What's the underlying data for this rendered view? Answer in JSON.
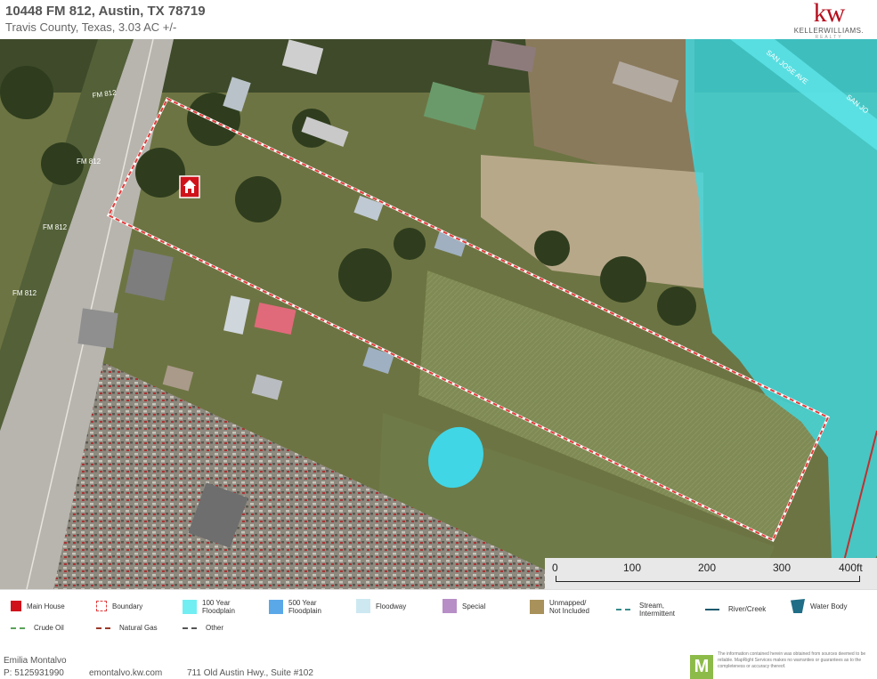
{
  "header": {
    "title": "10448 FM 812, Austin, TX 78719",
    "subtitle": "Travis County, Texas, 3.03 AC +/-"
  },
  "logo": {
    "mark": "kw",
    "name": "KELLERWILLIAMS.",
    "tagline": "REALTY",
    "color": "#b40f1e"
  },
  "map": {
    "road_labels": [
      "FM 812",
      "FM 812",
      "FM 812",
      "FM 812"
    ],
    "creek_label": "SAN JOSE AVE",
    "creek_label_2": "SAN JO",
    "colors": {
      "aerial_green": "#6b7a44",
      "floodplain": "#3fd8df",
      "boundary": "#e23b3b",
      "main_house": "#d0121b",
      "pond": "#40d6e6"
    }
  },
  "scalebar": {
    "labels": [
      "0",
      "100",
      "200",
      "300",
      "400ft"
    ]
  },
  "legend": [
    {
      "label": "Main House",
      "icon": "house-icon",
      "color": "#d0121b"
    },
    {
      "label": "Boundary",
      "icon": "boundary-icon",
      "color": "#e23b3b"
    },
    {
      "label": "100 Year\nFloodplain",
      "icon": "swatch",
      "color": "#71eef2"
    },
    {
      "label": "500 Year\nFloodplain",
      "icon": "swatch",
      "color": "#5aa8e8"
    },
    {
      "label": "Floodway",
      "icon": "swatch",
      "color": "#cde8f1"
    },
    {
      "label": "Special",
      "icon": "swatch",
      "color": "#b88ec6"
    },
    {
      "label": "Unmapped/\nNot Included",
      "icon": "swatch",
      "color": "#a8915a"
    },
    {
      "label": "Stream,\nIntermittent",
      "icon": "line",
      "color": "#3a8c8c"
    },
    {
      "label": "River/Creek",
      "icon": "line",
      "color": "#1d5a6e"
    },
    {
      "label": "Water Body",
      "icon": "water-body-icon",
      "color": "#1f6d86"
    },
    {
      "label": "Crude Oil",
      "icon": "line",
      "color": "#5aa35a"
    },
    {
      "label": "Natural Gas",
      "icon": "line",
      "color": "#9b3a2a"
    },
    {
      "label": "Other",
      "icon": "line",
      "color": "#555555"
    }
  ],
  "footer": {
    "agent": "Emilia Montalvo",
    "phone": "P: 5125931990",
    "website": "emontalvo.kw.com",
    "address": "711 Old Austin Hwy., Suite #102",
    "mapright_mark": "M",
    "disclaimer": "The information contained herein was obtained from sources deemed to be reliable. MapRight Services makes no warranties or guarantees as to the completeness or accuracy thereof."
  }
}
